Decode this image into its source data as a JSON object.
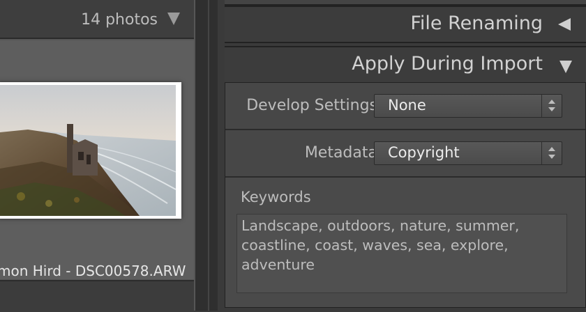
{
  "grid": {
    "photo_count": "14 photos",
    "thumbnail_caption": "mon Hird - DSC00578.ARW"
  },
  "panel": {
    "sections": [
      {
        "title": "File Renaming",
        "state": "collapsed"
      },
      {
        "title": "Apply During Import",
        "state": "expanded"
      }
    ],
    "develop_settings": {
      "label": "Develop Settings",
      "value": "None"
    },
    "metadata": {
      "label": "Metadata",
      "value": "Copyright"
    },
    "keywords": {
      "label": "Keywords",
      "value": "Landscape, outdoors, nature, summer, coastline, coast, waves, sea, explore, adventure"
    }
  },
  "icons": [
    "disclosure-arrow-down-icon",
    "disclosure-arrow-left-icon",
    "stepper-arrows-icon"
  ],
  "colors": {
    "panel_bg": "#3a3a3a",
    "text": "#c9c9c9",
    "value_text": "#ececec"
  }
}
